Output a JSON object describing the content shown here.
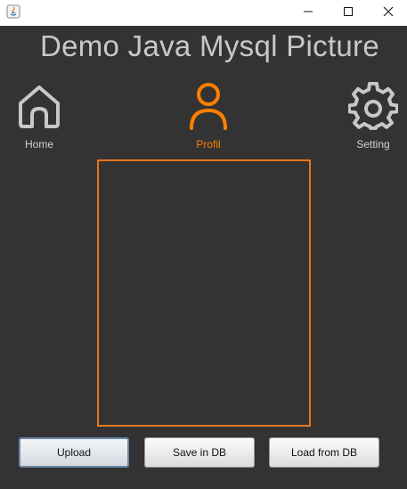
{
  "window": {
    "controls": [
      "minimize-icon",
      "maximize-icon",
      "close-icon"
    ]
  },
  "header": {
    "title": "Demo Java Mysql Picture"
  },
  "nav": {
    "items": [
      {
        "label": "Home",
        "icon": "home-icon",
        "active": false
      },
      {
        "label": "Profil",
        "icon": "user-icon",
        "active": true
      },
      {
        "label": "Setting",
        "icon": "gear-icon",
        "active": false
      }
    ]
  },
  "actions": {
    "upload_label": "Upload",
    "save_label": "Save in DB",
    "load_label": "Load from DB"
  },
  "colors": {
    "background": "#333333",
    "accent": "#ff7f00",
    "icon_inactive": "#c8c8c8"
  }
}
